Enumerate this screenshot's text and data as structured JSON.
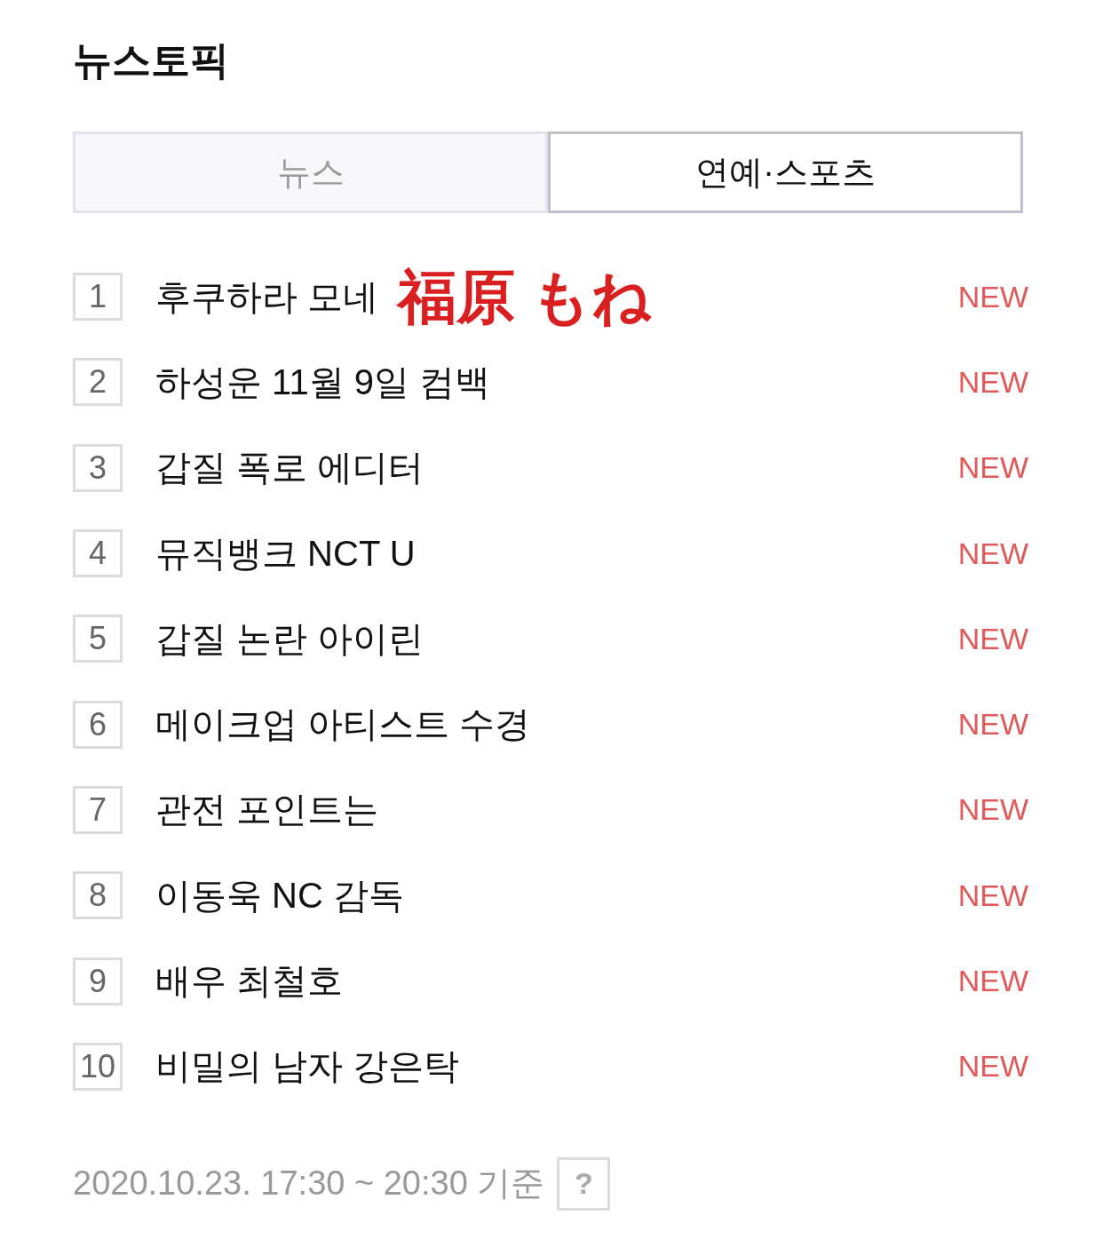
{
  "title": "뉴스토픽",
  "tabs": [
    {
      "label": "뉴스",
      "selected": false
    },
    {
      "label": "연예·스포츠",
      "selected": true
    }
  ],
  "rows": [
    {
      "rank": "1",
      "title": "후쿠하라 모네",
      "annotation": "福原 もね",
      "badge": "NEW"
    },
    {
      "rank": "2",
      "title": "하성운 11월 9일 컴백",
      "badge": "NEW"
    },
    {
      "rank": "3",
      "title": "갑질 폭로 에디터",
      "badge": "NEW"
    },
    {
      "rank": "4",
      "title": "뮤직뱅크 NCT U",
      "badge": "NEW"
    },
    {
      "rank": "5",
      "title": "갑질 논란 아이린",
      "badge": "NEW"
    },
    {
      "rank": "6",
      "title": "메이크업 아티스트 수경",
      "badge": "NEW"
    },
    {
      "rank": "7",
      "title": "관전 포인트는",
      "badge": "NEW"
    },
    {
      "rank": "8",
      "title": "이동욱 NC 감독",
      "badge": "NEW"
    },
    {
      "rank": "9",
      "title": "배우 최철호",
      "badge": "NEW"
    },
    {
      "rank": "10",
      "title": "비밀의 남자 강은탁",
      "badge": "NEW"
    }
  ],
  "footer": {
    "timestamp": "2020.10.23. 17:30 ~ 20:30 기준",
    "help": "?"
  }
}
